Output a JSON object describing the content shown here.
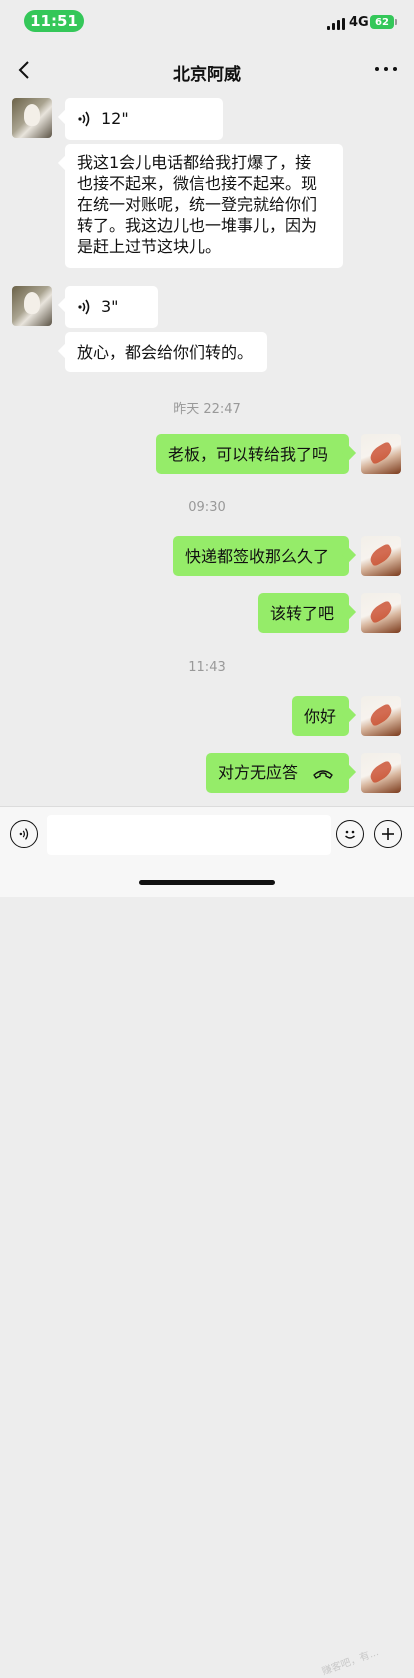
{
  "status": {
    "time": "11:51",
    "network": "4G",
    "battery": "62"
  },
  "nav": {
    "title": "北京阿威"
  },
  "messages": {
    "m1_voice": "12\"",
    "m2_text_lines": [
      "我这1会儿电话都给我打爆了，接",
      "也接不起来，微信也接不起来。现",
      "在统一对账呢，统一登完就给你们",
      "转了。我这边儿也一堆事儿，因为",
      "是赶上过节这块儿。"
    ],
    "m3_voice": "3\"",
    "m4_text": "放心，都会给你们转的。",
    "ts1": "昨天 22:47",
    "m5_text": "老板，可以转给我了吗",
    "ts2": "09:30",
    "m6_text": "快递都签收那么久了",
    "m7_text": "该转了吧",
    "ts3": "11:43",
    "m8_text": "你好",
    "m9_text": "对方无应答"
  },
  "watermark": "赚客吧，有..."
}
